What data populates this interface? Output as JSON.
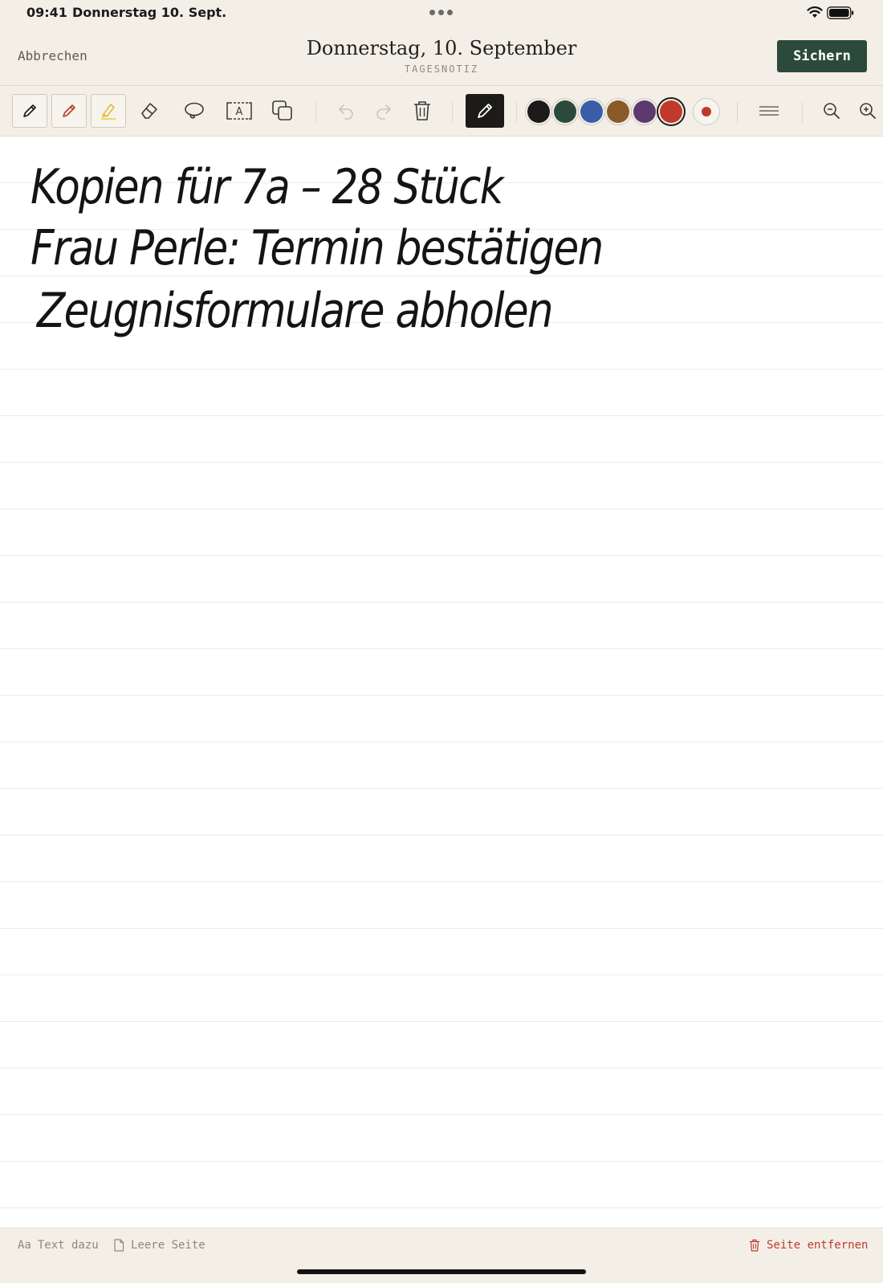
{
  "status": {
    "time": "09:41",
    "date": "Donnerstag 10. Sept."
  },
  "header": {
    "cancel_label": "Abbrechen",
    "title": "Donnerstag, 10. September",
    "subtitle": "TAGESNOTIZ",
    "save_label": "Sichern"
  },
  "toolbar": {
    "tools": [
      {
        "name": "pen-icon",
        "state": "selected"
      },
      {
        "name": "red-pen-icon"
      },
      {
        "name": "highlighter-icon"
      },
      {
        "name": "eraser-icon"
      },
      {
        "name": "lasso-icon"
      },
      {
        "name": "text-box-icon",
        "glyph": "A"
      },
      {
        "name": "shapes-icon"
      },
      {
        "name": "undo-icon",
        "disabled": true
      },
      {
        "name": "redo-icon",
        "disabled": true
      },
      {
        "name": "trash-icon"
      },
      {
        "name": "active-pen-icon"
      }
    ],
    "colors": [
      "#1c1b19",
      "#2c4a3c",
      "#3a5da8",
      "#8b5a2b",
      "#5b3b6e",
      "#c0392b"
    ],
    "selected_color": "#c0392b",
    "stroke_size_color": "#c0392b"
  },
  "note": {
    "lines": [
      "Kopien für 7a – 28 Stück",
      "Frau Perle: Termin bestätigen",
      "Zeugnisformulare abholen"
    ]
  },
  "footer": {
    "add_text_prefix": "Aa",
    "add_text_label": "Text dazu",
    "blank_page_label": "Leere Seite",
    "remove_page_label": "Seite entfernen"
  }
}
